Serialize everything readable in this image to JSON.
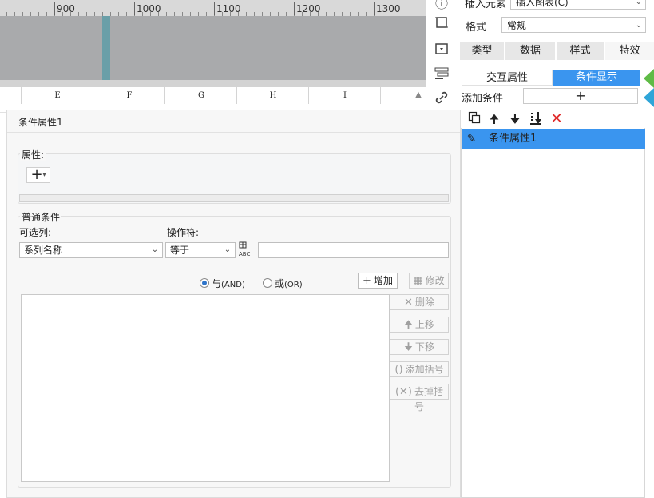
{
  "ruler": {
    "labels": [
      "900",
      "1000",
      "1100",
      "1200",
      "1300"
    ]
  },
  "columns": [
    "E",
    "F",
    "G",
    "H",
    "I"
  ],
  "right_panel": {
    "insert_label": "插入元素",
    "insert_value": "插入图表(C)",
    "format_label": "格式",
    "format_value": "常规",
    "tabs": [
      "类型",
      "数据",
      "样式",
      "特效"
    ],
    "active_tab": "特效",
    "segments": [
      "交互属性",
      "条件显示"
    ],
    "add_condition_label": "添加条件",
    "add_symbol": "+",
    "toolbar_icons": [
      "copy-icon",
      "arrow-up-icon",
      "arrow-down-icon",
      "move-bottom-icon",
      "delete-icon"
    ],
    "condition_item": "条件属性1",
    "accent_color": "#3a95ef"
  },
  "dialog": {
    "title": "条件属性1",
    "attribute_legend": "属性:",
    "add_symbol": "+",
    "normal_condition_legend": "普通条件",
    "column_label": "可选列:",
    "column_value": "系列名称",
    "operator_label": "操作符:",
    "operator_value": "等于",
    "abc_text": "ABC",
    "radio_and_main": "与",
    "radio_and_sub": "(AND)",
    "radio_or_main": "或",
    "radio_or_sub": "(OR)",
    "radio_selected": "and",
    "add_button": "增加",
    "modify_button": "修改",
    "delete_button": "删除",
    "move_up_button": "上移",
    "move_down_button": "下移",
    "add_bracket_button": "添加括号",
    "remove_bracket_button": "去掉括号"
  }
}
